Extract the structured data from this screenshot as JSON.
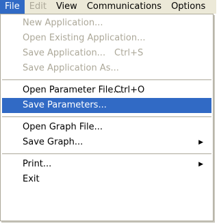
{
  "menubar": {
    "items": [
      {
        "label": "File"
      },
      {
        "label": "Edit"
      },
      {
        "label": "View"
      },
      {
        "label": "Communications"
      },
      {
        "label": "Options"
      }
    ]
  },
  "file_menu": {
    "new_application": "New Application...",
    "open_existing_application": "Open Existing Application...",
    "save_application": "Save Application...",
    "save_application_shortcut": "Ctrl+S",
    "save_application_as": "Save Application As...",
    "open_parameter_file": "Open Parameter File...",
    "open_parameter_file_shortcut": "Ctrl+O",
    "save_parameters": "Save Parameters...",
    "open_graph_file": "Open Graph File...",
    "save_graph": "Save Graph...",
    "print": "Print...",
    "exit": "Exit"
  },
  "colors": {
    "highlight": "#316ac5",
    "disabled_text": "#aca899",
    "menubar_bg": "#ece9d8"
  }
}
